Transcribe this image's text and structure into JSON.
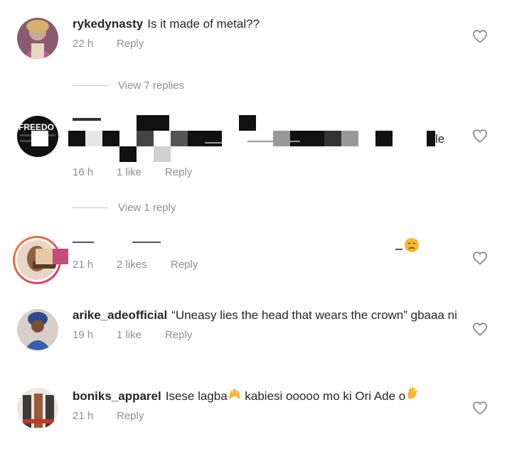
{
  "comments": [
    {
      "username": "rykedynasty",
      "text": "Is it made of metal??",
      "time": "22 h",
      "likes": "",
      "reply_label": "Reply"
    },
    {
      "username": "",
      "text": "le",
      "time": "16 h",
      "likes": "1 like",
      "reply_label": "Reply"
    },
    {
      "username": "",
      "text": "",
      "time": "21 h",
      "likes": "2 likes",
      "reply_label": "Reply"
    },
    {
      "username": "arike_adeofficial",
      "text": "“Uneasy lies the head that wears the crown” gbaaa ni",
      "time": "19 h",
      "likes": "1 like",
      "reply_label": "Reply"
    },
    {
      "username": "boniks_apparel",
      "text_parts": [
        "Isese lagba",
        " kabiesi ooooo mo ki Ori Ade o"
      ],
      "time": "21 h",
      "likes": "",
      "reply_label": "Reply"
    }
  ],
  "view_replies": [
    {
      "label": "View 7 replies"
    },
    {
      "label": "View 1 reply"
    }
  ],
  "avatar_text": "FREEDO",
  "icons": {
    "like": "heart-outline-icon",
    "raised_hands": "raised-hands-emoji",
    "waving_hand": "waving-hand-emoji",
    "sad_face": "disappointed-face-emoji"
  },
  "colors": {
    "primary_text": "#262626",
    "secondary_text": "#8e8e8e",
    "story_ring_start": "#f58529",
    "story_ring_end": "#dd2a7b"
  }
}
